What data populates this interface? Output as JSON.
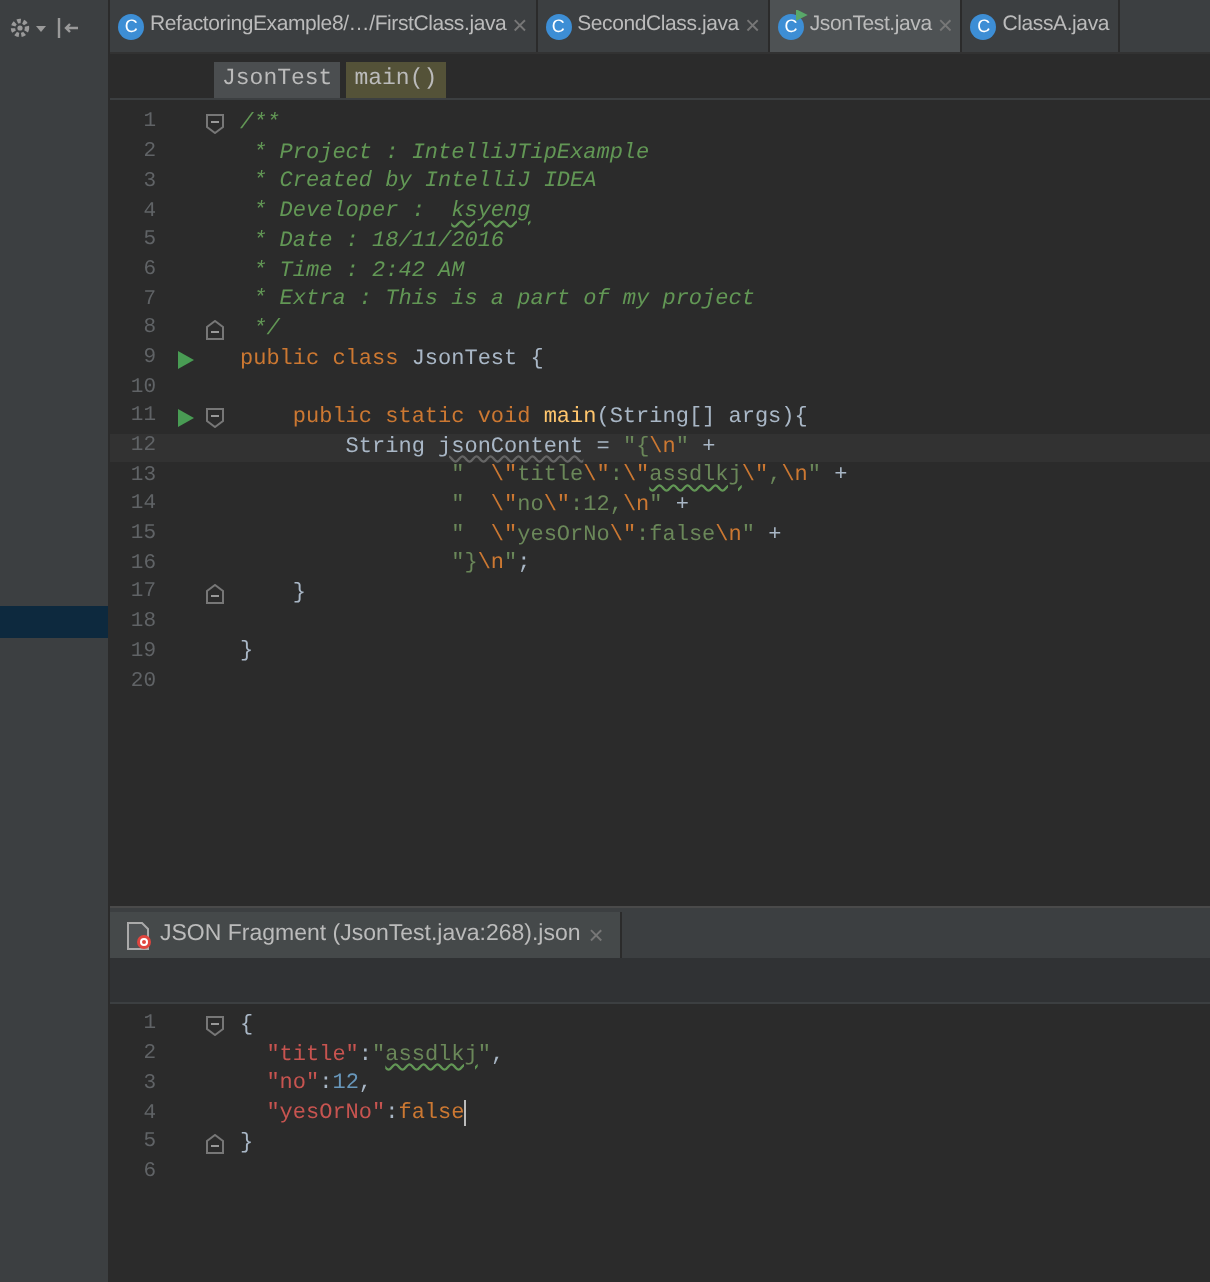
{
  "tabs": [
    {
      "label": "RefactoringExample8/…/FirstClass.java",
      "icon": "C",
      "close": "×",
      "selected": false,
      "running": false
    },
    {
      "label": "SecondClass.java",
      "icon": "C",
      "close": "×",
      "selected": false,
      "running": false
    },
    {
      "label": "JsonTest.java",
      "icon": "C",
      "close": "×",
      "selected": true,
      "running": true
    },
    {
      "label": "ClassA.java",
      "icon": "C",
      "selected": false,
      "running": false
    }
  ],
  "breadcrumbs": [
    {
      "label": "JsonTest",
      "kind": "class"
    },
    {
      "label": "main()",
      "kind": "method"
    }
  ],
  "editor": {
    "lines": [
      {
        "number": "1",
        "fold_open": true,
        "tokens": [
          {
            "kind": "cmt",
            "text": "/**"
          }
        ]
      },
      {
        "number": "2",
        "tokens": [
          {
            "kind": "cmt",
            "text": " * Project : IntelliJTipExample"
          }
        ]
      },
      {
        "number": "3",
        "tokens": [
          {
            "kind": "cmt",
            "text": " * Created by IntelliJ IDEA"
          }
        ]
      },
      {
        "number": "4",
        "tokens": [
          {
            "kind": "cmt",
            "text": " * Developer :  "
          },
          {
            "kind": "cmttypo",
            "text": "ksyeng"
          }
        ]
      },
      {
        "number": "5",
        "tokens": [
          {
            "kind": "cmt",
            "text": " * Date : 18/11/2016"
          }
        ]
      },
      {
        "number": "6",
        "tokens": [
          {
            "kind": "cmt",
            "text": " * Time : 2:42 AM"
          }
        ]
      },
      {
        "number": "7",
        "tokens": [
          {
            "kind": "cmt",
            "text": " * Extra : This is a part of my project"
          }
        ]
      },
      {
        "number": "8",
        "fold_close": true,
        "tokens": [
          {
            "kind": "cmt",
            "text": " */"
          }
        ]
      },
      {
        "number": "9",
        "run": true,
        "tokens": [
          {
            "kind": "kw",
            "text": "public class "
          },
          {
            "kind": "plain",
            "text": "JsonTest {"
          }
        ]
      },
      {
        "number": "10"
      },
      {
        "number": "11",
        "run": true,
        "fold_open": true,
        "tokens": [
          {
            "kind": "kw",
            "text": "    public static void "
          },
          {
            "kind": "fn",
            "text": "main"
          },
          {
            "kind": "plain",
            "text": "(String[] args){"
          }
        ]
      },
      {
        "number": "12",
        "current": true,
        "tokens": [
          {
            "kind": "plain",
            "text": "        String "
          },
          {
            "kind": "unused",
            "text": "jsonContent"
          },
          {
            "kind": "plain",
            "text": " = "
          },
          {
            "kind": "str",
            "text": "\"{"
          },
          {
            "kind": "esc",
            "text": "\\n"
          },
          {
            "kind": "str",
            "text": "\""
          },
          {
            "kind": "plain",
            "text": " +"
          }
        ]
      },
      {
        "number": "13",
        "tokens": [
          {
            "kind": "str",
            "text": "                \"  "
          },
          {
            "kind": "esc",
            "text": "\\\""
          },
          {
            "kind": "str",
            "text": "title"
          },
          {
            "kind": "esc",
            "text": "\\\""
          },
          {
            "kind": "str",
            "text": ":"
          },
          {
            "kind": "esc",
            "text": "\\\""
          },
          {
            "kind": "strtypo",
            "text": "assdlkj"
          },
          {
            "kind": "esc",
            "text": "\\\""
          },
          {
            "kind": "str",
            "text": ","
          },
          {
            "kind": "esc",
            "text": "\\n"
          },
          {
            "kind": "str",
            "text": "\""
          },
          {
            "kind": "plain",
            "text": " +"
          }
        ]
      },
      {
        "number": "14",
        "tokens": [
          {
            "kind": "str",
            "text": "                \"  "
          },
          {
            "kind": "esc",
            "text": "\\\""
          },
          {
            "kind": "str",
            "text": "no"
          },
          {
            "kind": "esc",
            "text": "\\\""
          },
          {
            "kind": "str",
            "text": ":12,"
          },
          {
            "kind": "esc",
            "text": "\\n"
          },
          {
            "kind": "str",
            "text": "\""
          },
          {
            "kind": "plain",
            "text": " +"
          }
        ]
      },
      {
        "number": "15",
        "tokens": [
          {
            "kind": "str",
            "text": "                \"  "
          },
          {
            "kind": "esc",
            "text": "\\\""
          },
          {
            "kind": "str",
            "text": "yesOrNo"
          },
          {
            "kind": "esc",
            "text": "\\\""
          },
          {
            "kind": "str",
            "text": ":false"
          },
          {
            "kind": "esc",
            "text": "\\n"
          },
          {
            "kind": "str",
            "text": "\""
          },
          {
            "kind": "plain",
            "text": " +"
          }
        ]
      },
      {
        "number": "16",
        "tokens": [
          {
            "kind": "str",
            "text": "                \"}"
          },
          {
            "kind": "esc",
            "text": "\\n"
          },
          {
            "kind": "str",
            "text": "\""
          },
          {
            "kind": "plain",
            "text": ";"
          }
        ]
      },
      {
        "number": "17",
        "fold_close": true,
        "tokens": [
          {
            "kind": "plain",
            "text": "    }"
          }
        ]
      },
      {
        "number": "18"
      },
      {
        "number": "19",
        "tokens": [
          {
            "kind": "plain",
            "text": "}"
          }
        ]
      },
      {
        "number": "20"
      }
    ]
  },
  "fragment_tab": {
    "label": "JSON Fragment (JsonTest.java:268).json",
    "close": "×",
    "error": true
  },
  "fragment": {
    "lines": [
      {
        "number": "1",
        "fold_open": true,
        "tokens": [
          {
            "kind": "plain",
            "text": "{"
          }
        ]
      },
      {
        "number": "2",
        "tokens": [
          {
            "kind": "key",
            "text": "  \"title\""
          },
          {
            "kind": "plain",
            "text": ":"
          },
          {
            "kind": "jstr",
            "text": "\""
          },
          {
            "kind": "strtypo",
            "text": "assdlkj"
          },
          {
            "kind": "jstr",
            "text": "\""
          },
          {
            "kind": "plain",
            "text": ","
          }
        ]
      },
      {
        "number": "3",
        "tokens": [
          {
            "kind": "key",
            "text": "  \"no\""
          },
          {
            "kind": "plain",
            "text": ":"
          },
          {
            "kind": "num",
            "text": "12"
          },
          {
            "kind": "plain",
            "text": ","
          }
        ]
      },
      {
        "number": "4",
        "caret": true,
        "tokens": [
          {
            "kind": "key",
            "text": "  \"yesOrNo\""
          },
          {
            "kind": "plain",
            "text": ":"
          },
          {
            "kind": "kw",
            "text": "false"
          }
        ]
      },
      {
        "number": "5",
        "fold_close": true,
        "tokens": [
          {
            "kind": "plain",
            "text": "}"
          }
        ]
      },
      {
        "number": "6"
      }
    ]
  }
}
